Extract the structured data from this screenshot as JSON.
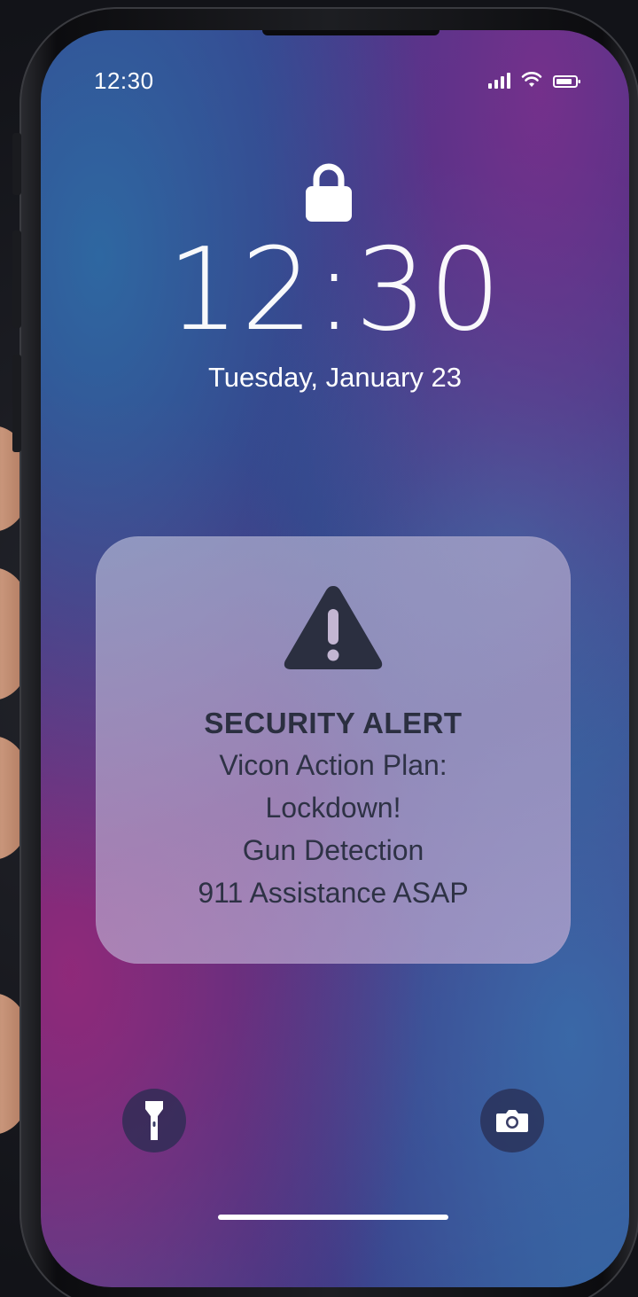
{
  "status_bar": {
    "time": "12:30",
    "icons": [
      "cellular-signal-icon",
      "wifi-icon",
      "battery-icon"
    ]
  },
  "lock_screen": {
    "lock_icon": "lock-icon",
    "time": "12:30",
    "date": "Tuesday, January 23"
  },
  "alert": {
    "icon": "warning-icon",
    "title": "SECURITY ALERT",
    "lines": [
      "Vicon Action Plan:",
      "Lockdown!",
      "Gun Detection",
      "911 Assistance ASAP"
    ]
  },
  "quick_actions": {
    "left": "flashlight-icon",
    "right": "camera-icon"
  },
  "colors": {
    "alert_text": "#2b2f40",
    "screen_text": "#ffffff"
  }
}
